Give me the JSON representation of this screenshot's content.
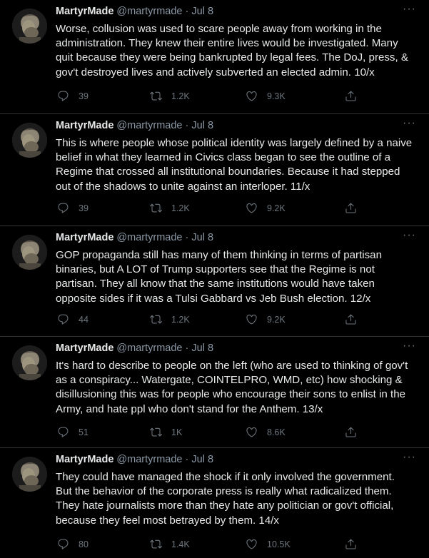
{
  "tweets": [
    {
      "name": "MartyrMade",
      "handle": "@martyrmade",
      "sep": "·",
      "date": "Jul 8",
      "text": "Worse, collusion was used to scare people away from working in the administration. They knew their entire lives would be investigated. Many quit because they were being bankrupted by legal fees. The DoJ, press, & gov't destroyed lives and actively subverted an elected admin. 10/x",
      "replies": "39",
      "retweets": "1.2K",
      "likes": "9.3K"
    },
    {
      "name": "MartyrMade",
      "handle": "@martyrmade",
      "sep": "·",
      "date": "Jul 8",
      "text": "This is where people whose political identity was largely defined by a naive belief in what they learned in Civics class began to see the outline of a Regime that crossed all institutional boundaries. Because it had stepped out of the shadows to unite against an interloper. 11/x",
      "replies": "39",
      "retweets": "1.2K",
      "likes": "9.2K"
    },
    {
      "name": "MartyrMade",
      "handle": "@martyrmade",
      "sep": "·",
      "date": "Jul 8",
      "text": "GOP propaganda still has many of them thinking in terms of partisan binaries, but A LOT of Trump supporters see that the Regime is not partisan. They all know that the same institutions would have taken opposite sides if it was a Tulsi Gabbard vs Jeb Bush election. 12/x",
      "replies": "44",
      "retweets": "1.2K",
      "likes": "9.2K"
    },
    {
      "name": "MartyrMade",
      "handle": "@martyrmade",
      "sep": "·",
      "date": "Jul 8",
      "text": "It's hard to describe to people on the left (who are used to thinking of gov't as a conspiracy... Watergate, COINTELPRO, WMD, etc) how shocking & disillusioning this was for people who encourage their sons to enlist in the Army, and hate ppl who don't stand for the Anthem. 13/x",
      "replies": "51",
      "retweets": "1K",
      "likes": "8.6K"
    },
    {
      "name": "MartyrMade",
      "handle": "@martyrmade",
      "sep": "·",
      "date": "Jul 8",
      "text": "They could have managed the shock if it only involved the government. But the behavior of the corporate press is really what radicalized them. They hate journalists more than they hate any politician or gov't official, because they feel most betrayed by them. 14/x",
      "replies": "80",
      "retweets": "1.4K",
      "likes": "10.5K"
    }
  ],
  "more_icon": "more-horizontal-icon",
  "icons": [
    "reply-icon",
    "retweet-icon",
    "like-icon",
    "share-icon"
  ]
}
